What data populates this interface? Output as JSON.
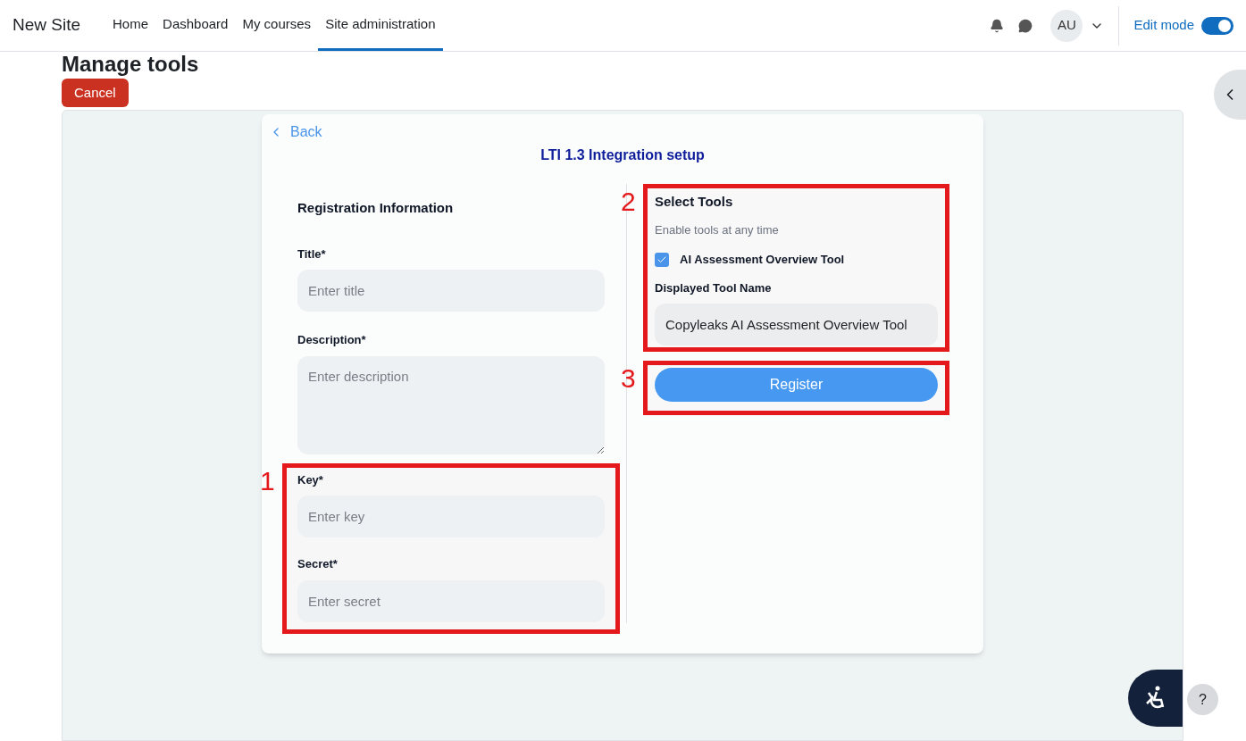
{
  "navbar": {
    "site_name": "New Site",
    "links": [
      {
        "label": "Home",
        "selected": false
      },
      {
        "label": "Dashboard",
        "selected": false
      },
      {
        "label": "My courses",
        "selected": false
      },
      {
        "label": "Site administration",
        "selected": true
      }
    ],
    "avatar": "AU",
    "edit_mode": {
      "label": "Edit mode",
      "on": true
    }
  },
  "page": {
    "heading": "Manage tools",
    "cancel": "Cancel"
  },
  "setup": {
    "back": "Back",
    "title": "LTI 1.3 Integration setup",
    "registration": {
      "heading": "Registration Information",
      "fields": [
        {
          "label": "Title*",
          "placeholder": "Enter title",
          "kind": "input"
        },
        {
          "label": "Description*",
          "placeholder": "Enter description",
          "kind": "textarea"
        }
      ],
      "credentials": {
        "annotation": "1",
        "fields": [
          {
            "label": "Key*",
            "placeholder": "Enter key",
            "kind": "input"
          },
          {
            "label": "Secret*",
            "placeholder": "Enter secret",
            "kind": "input"
          }
        ]
      }
    },
    "tools": {
      "annotation": "2",
      "heading": "Select Tools",
      "hint": "Enable tools at any time",
      "items": [
        {
          "label": "AI Assessment Overview Tool",
          "checked": true
        }
      ],
      "name_label": "Displayed Tool Name",
      "name_value": "Copyleaks AI Assessment Overview Tool"
    },
    "register": {
      "annotation": "3",
      "label": "Register"
    }
  },
  "help": "?"
}
